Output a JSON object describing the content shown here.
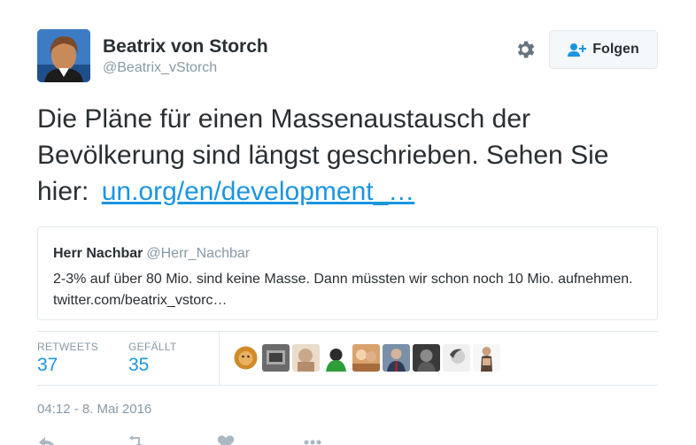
{
  "author": {
    "name": "Beatrix von Storch",
    "handle": "@Beatrix_vStorch"
  },
  "header": {
    "settings_icon": "gear-icon",
    "follow_label": "Folgen",
    "follow_icon": "add-user-icon"
  },
  "tweet": {
    "text": "Die Pläne für einen Massenaustausch der Bevölkerung sind längst geschrieben. Sehen Sie hier:",
    "link_text": "un.org/en/development_…"
  },
  "quote": {
    "name": "Herr Nachbar",
    "handle": "@Herr_Nachbar",
    "text": "2-3% auf über 80 Mio. sind keine Masse. Dann müssten wir schon noch 10 Mio. aufnehmen. twitter.com/beatrix_vstorc…"
  },
  "stats": {
    "retweets_label": "RETWEETS",
    "retweets_value": "37",
    "likes_label": "GEFÄLLT",
    "likes_value": "35"
  },
  "timestamp": "04:12 - 8. Mai 2016",
  "actions": [
    "reply-icon",
    "retweet-icon",
    "like-icon",
    "more-icon"
  ],
  "colors": {
    "link": "#1b95e0",
    "muted": "#8899a6",
    "text": "#292f33",
    "border": "#e1e8ed"
  }
}
